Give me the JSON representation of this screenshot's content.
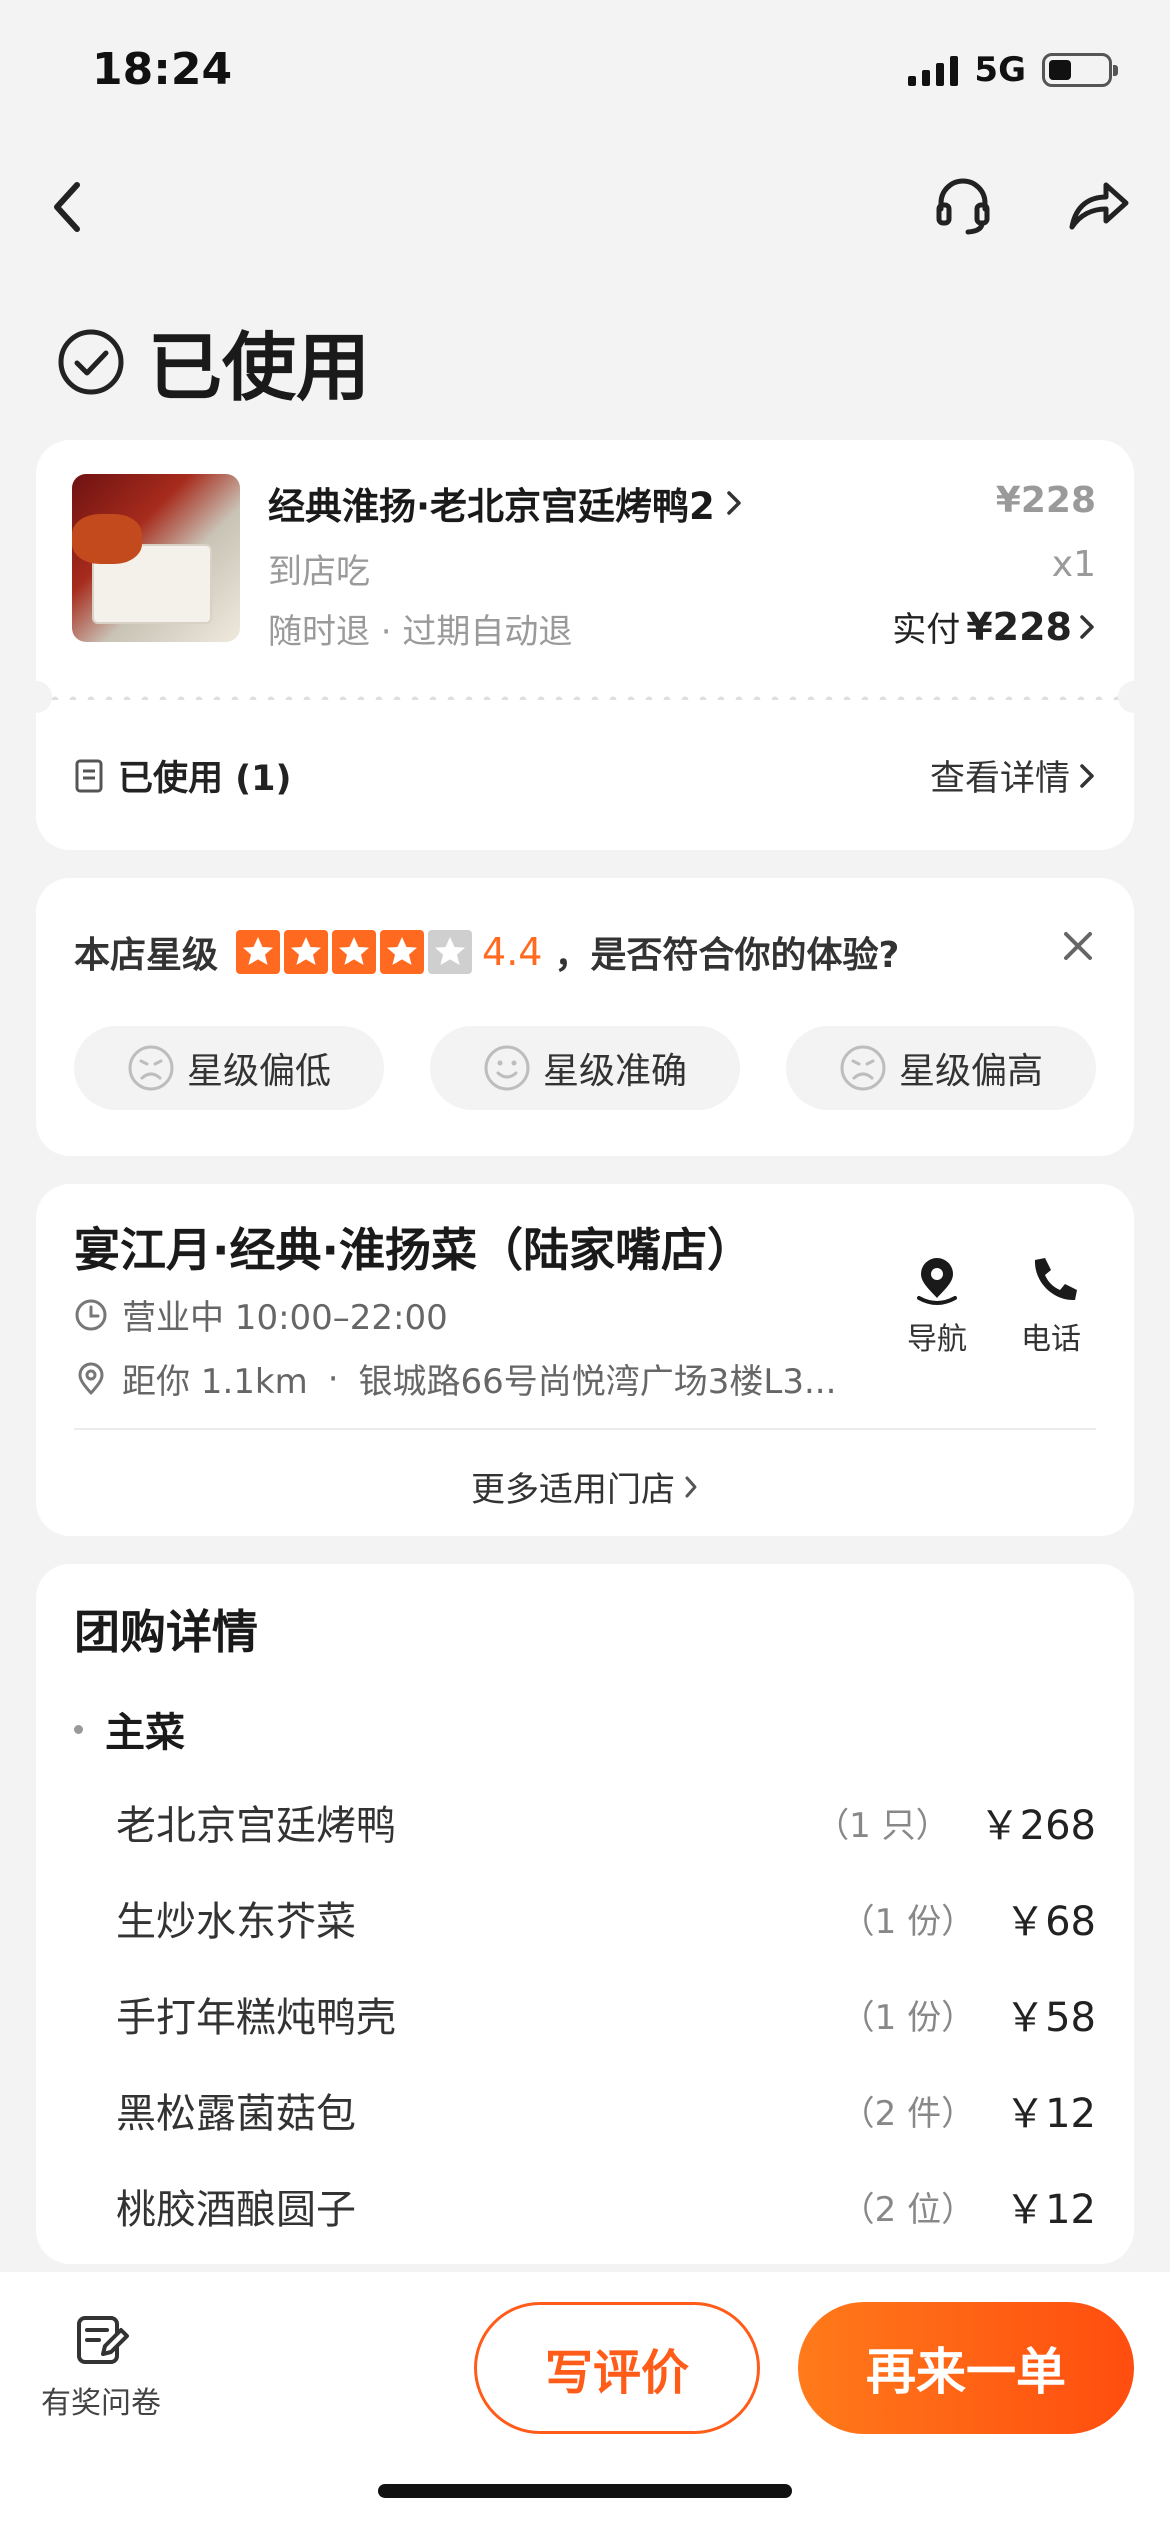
{
  "status": {
    "time": "18:24",
    "network": "5G"
  },
  "title": "已使用",
  "order": {
    "name": "经典淮扬·老北京宫廷烤鸭2",
    "dine_type": "到店吃",
    "refund_policy": "随时退 · 过期自动退",
    "price": "¥228",
    "quantity": "x1",
    "paid_label": "实付",
    "paid_amount": "¥228",
    "used_label": "已使用 (1)",
    "detail_link": "查看详情"
  },
  "rating": {
    "prefix": "本店星级",
    "score": "4.4",
    "stars": 4,
    "question": "，是否符合你的体验?",
    "options": [
      "星级偏低",
      "星级准确",
      "星级偏高"
    ]
  },
  "store": {
    "name": "宴江月·经典·淮扬菜（陆家嘴店）",
    "hours": "营业中 10:00–22:00",
    "distance": "距你 1.1km",
    "address": "银城路66号尚悦湾广场3楼L3...",
    "nav_label": "导航",
    "phone_label": "电话",
    "more_stores": "更多适用门店"
  },
  "group_detail": {
    "title": "团购详情",
    "section": "主菜",
    "dishes": [
      {
        "name": "老北京宫廷烤鸭",
        "unit": "（1 只）",
        "price": "￥268"
      },
      {
        "name": "生炒水东芥菜",
        "unit": "（1 份）",
        "price": "￥68"
      },
      {
        "name": "手打年糕炖鸭壳",
        "unit": "（1 份）",
        "price": "￥58"
      },
      {
        "name": "黑松露菌菇包",
        "unit": "（2 件）",
        "price": "￥12"
      },
      {
        "name": "桃胶酒酿圆子",
        "unit": "（2 位）",
        "price": "￥12"
      }
    ]
  },
  "bottom": {
    "survey_label": "有奖问卷",
    "review_button": "写评价",
    "reorder_button": "再来一单"
  },
  "colors": {
    "accent": "#ff5c1a",
    "star": "#ff6a20"
  }
}
